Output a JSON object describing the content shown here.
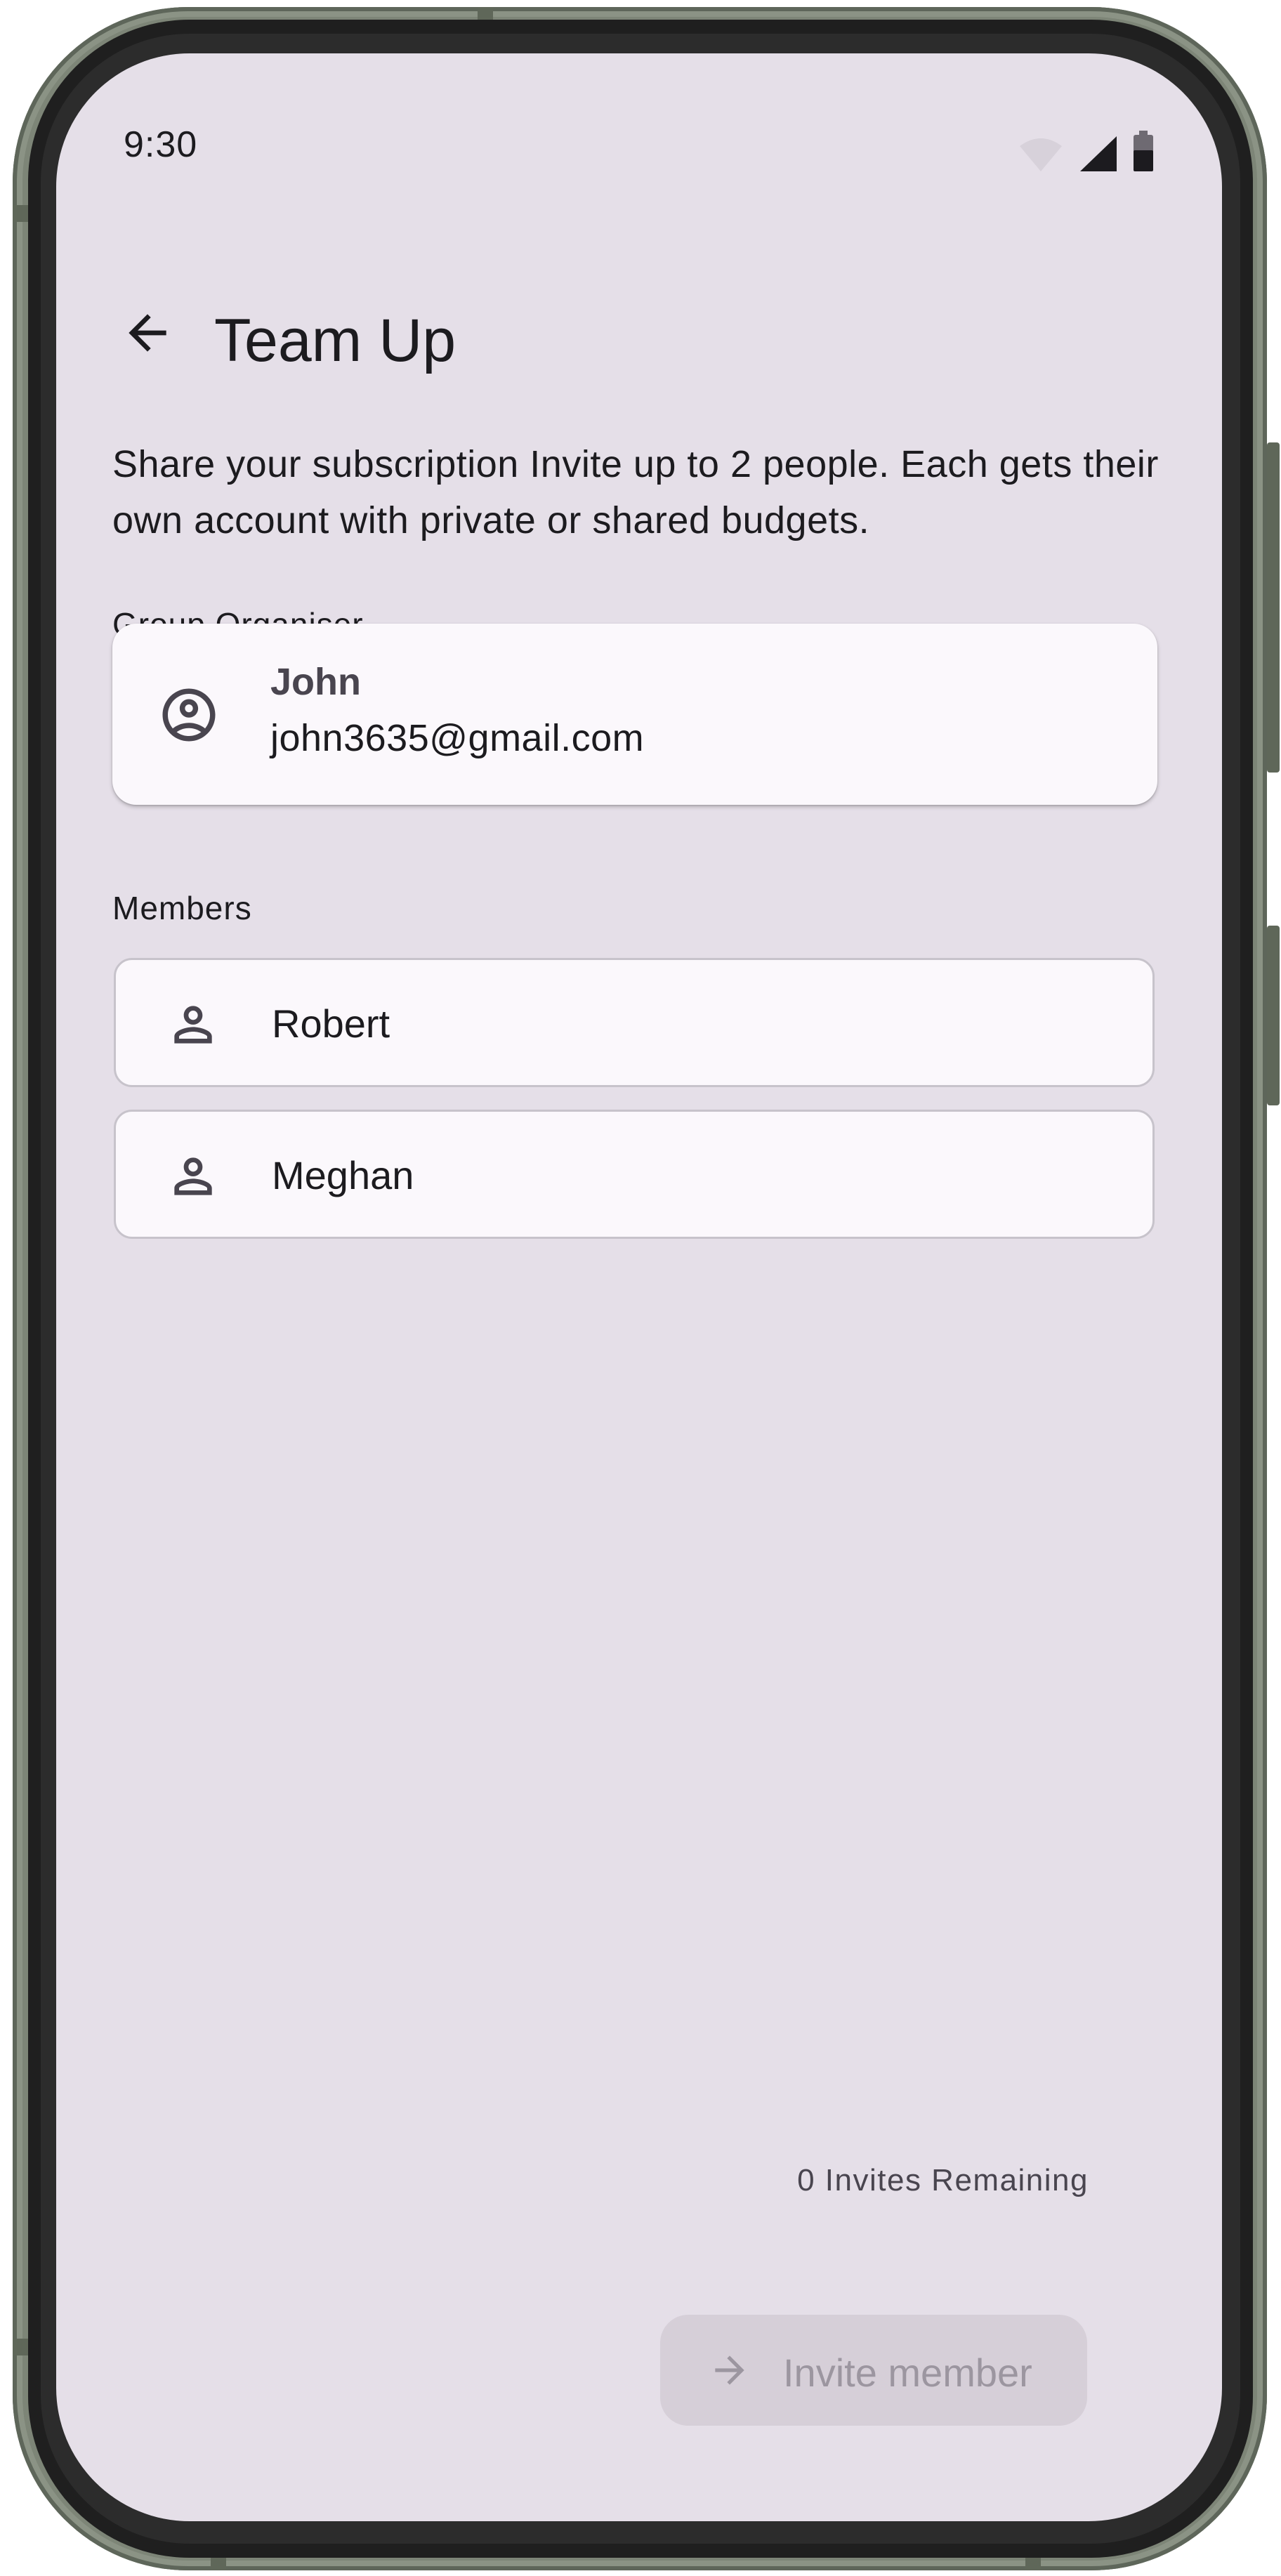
{
  "status_bar": {
    "time": "9:30",
    "icons": [
      "wifi-icon",
      "signal-icon",
      "battery-icon"
    ]
  },
  "header": {
    "back_icon": "arrow-left-icon",
    "title": "Team Up"
  },
  "description": "Share your subscription Invite up to 2 people. Each gets their own account with private or shared budgets.",
  "organiser": {
    "section_label": "Group Organiser",
    "icon": "account-circle-icon",
    "name": "John",
    "email": "john3635@gmail.com"
  },
  "members": {
    "section_label": "Members",
    "items": [
      {
        "icon": "person-icon",
        "name": "Robert"
      },
      {
        "icon": "person-icon",
        "name": "Meghan"
      }
    ]
  },
  "invites_remaining": "0 Invites Remaining",
  "invite_button": {
    "icon": "arrow-right-icon",
    "label": "Invite member",
    "disabled": true
  },
  "colors": {
    "screen_background": "#e5dfe8",
    "card_background": "#fbf8fc",
    "text_primary": "#1c1b1f",
    "text_secondary": "#49454f",
    "button_disabled_bg": "#d6cfd8",
    "button_disabled_text": "#9c96a0",
    "frame": "#7d8577"
  }
}
